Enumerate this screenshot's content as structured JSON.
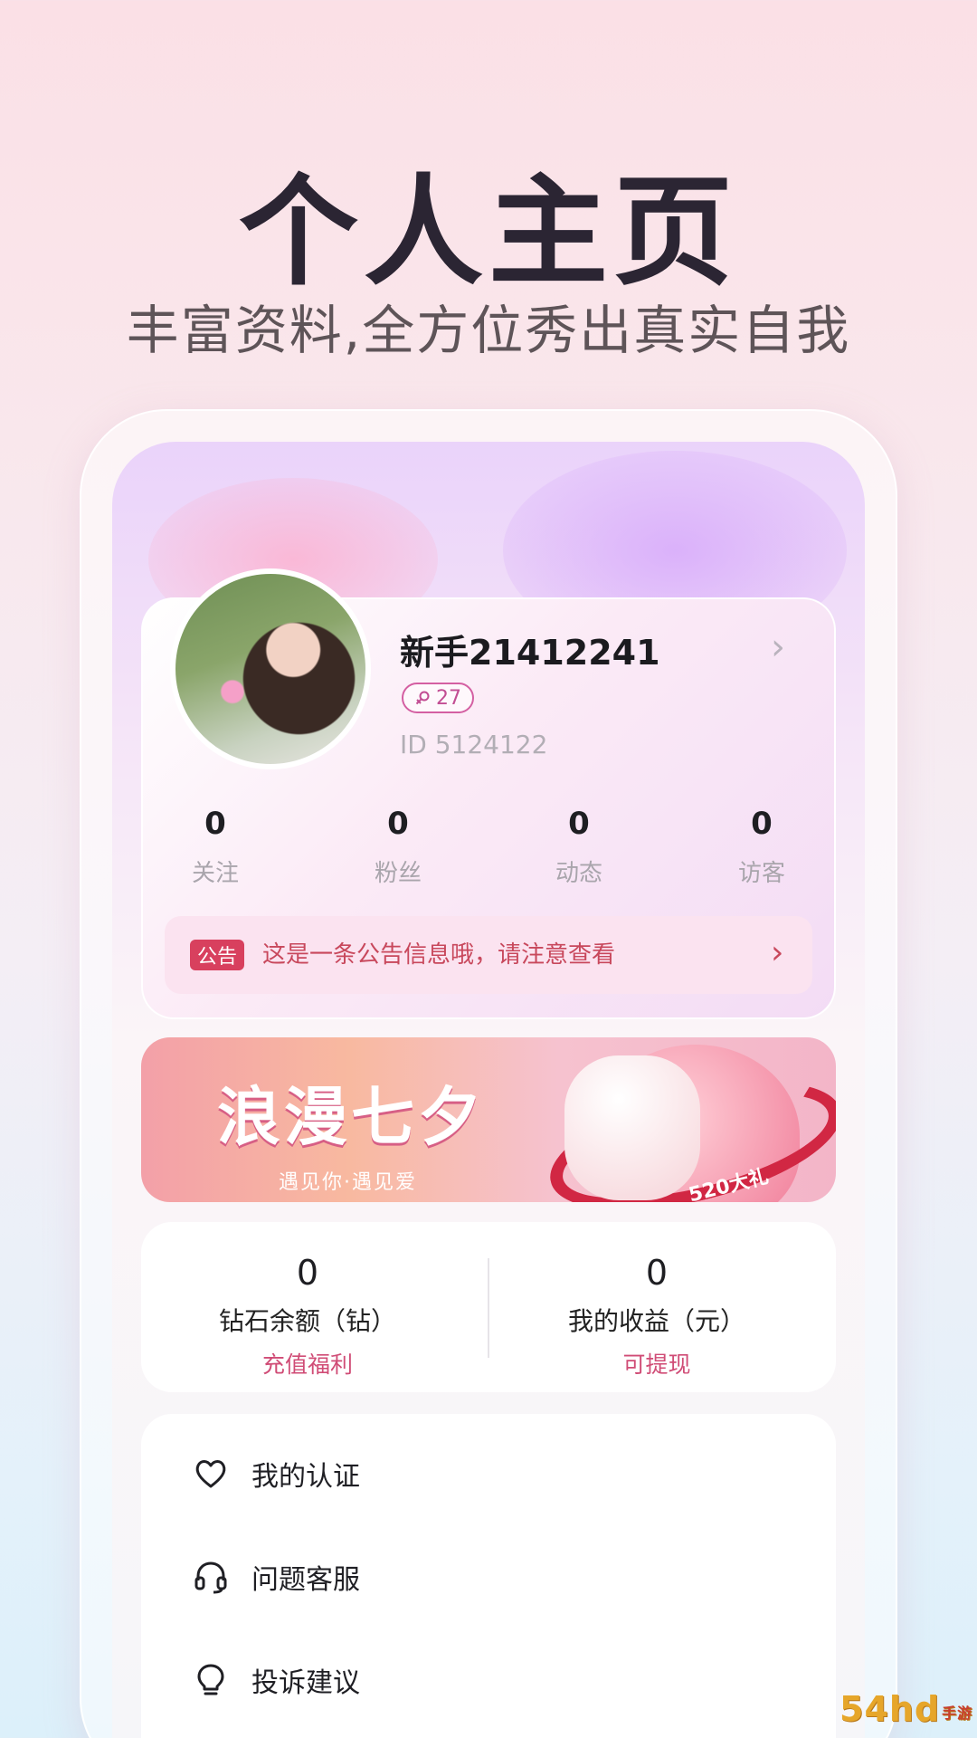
{
  "promo": {
    "headline": "个人主页",
    "subline": "丰富资料,全方位秀出真实自我"
  },
  "profile": {
    "username": "新手21412241",
    "age": "27",
    "id_text": "ID 5124122"
  },
  "stats": [
    {
      "value": "0",
      "label": "关注"
    },
    {
      "value": "0",
      "label": "粉丝"
    },
    {
      "value": "0",
      "label": "动态"
    },
    {
      "value": "0",
      "label": "访客"
    }
  ],
  "notice": {
    "tag": "公告",
    "text": "这是一条公告信息哦，请注意查看"
  },
  "banner": {
    "title": "浪漫七夕",
    "subtitle": "遇见你·遇见爱",
    "gift_text": "520大礼"
  },
  "wallet": {
    "diamond": {
      "value": "0",
      "label": "钻石余额（钻）",
      "action": "充值福利"
    },
    "income": {
      "value": "0",
      "label": "我的收益（元）",
      "action": "可提现"
    }
  },
  "menu": [
    {
      "label": "我的认证",
      "icon": "heart-icon"
    },
    {
      "label": "问题客服",
      "icon": "headset-icon"
    },
    {
      "label": "投诉建议",
      "icon": "lightbulb-icon"
    }
  ],
  "watermark": {
    "main": "54hd",
    "sub": "手游网"
  },
  "colors": {
    "accent": "#d04c76",
    "notice_tag": "#d8405e",
    "headline": "#2b2533"
  }
}
